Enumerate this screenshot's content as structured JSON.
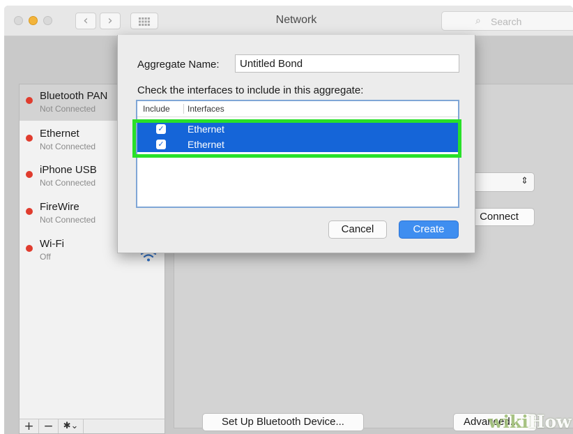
{
  "window": {
    "title": "Network",
    "search_placeholder": "Search"
  },
  "sidebar": {
    "services": [
      {
        "name": "Bluetooth PAN",
        "status": "Not Connected",
        "dot_color": "#e03c2e"
      },
      {
        "name": "Ethernet",
        "status": "Not Connected",
        "dot_color": "#e03c2e"
      },
      {
        "name": "iPhone USB",
        "status": "Not Connected",
        "dot_color": "#e03c2e"
      },
      {
        "name": "FireWire",
        "status": "Not Connected",
        "dot_color": "#e03c2e"
      },
      {
        "name": "Wi-Fi",
        "status": "Off",
        "dot_color": "#e03c2e"
      }
    ],
    "selected_index": 0,
    "add_label": "+",
    "remove_label": "−",
    "action_label": "✱⌄"
  },
  "main": {
    "connect_label": "Connect",
    "setup_bluetooth_label": "Set Up Bluetooth Device...",
    "advanced_label": "Advanced..."
  },
  "sheet": {
    "aggregate_name_label": "Aggregate Name:",
    "aggregate_name_value": "Untitled Bond",
    "instruction": "Check the interfaces to include in this aggregate:",
    "columns": [
      "Include",
      "Interfaces"
    ],
    "rows": [
      {
        "interface": "Ethernet",
        "included": true
      },
      {
        "interface": "Ethernet",
        "included": true
      }
    ],
    "cancel_label": "Cancel",
    "create_label": "Create",
    "accent_color": "#3f8ef0",
    "highlight_color": "#28e028"
  },
  "watermark": {
    "part1": "wiki",
    "part2": "How"
  }
}
